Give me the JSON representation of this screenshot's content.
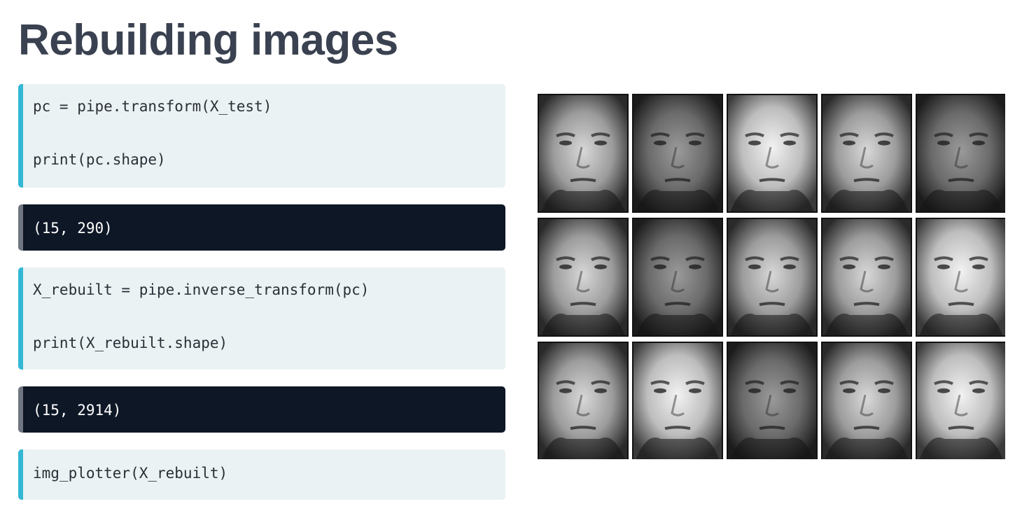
{
  "slide": {
    "title": "Rebuilding images"
  },
  "code_cells": [
    {
      "kind": "input",
      "lines": [
        "pc = pipe.transform(X_test)",
        "print(pc.shape)"
      ]
    },
    {
      "kind": "output",
      "lines": [
        "(15, 290)"
      ]
    },
    {
      "kind": "input",
      "lines": [
        "X_rebuilt = pipe.inverse_transform(pc)",
        "print(X_rebuilt.shape)"
      ]
    },
    {
      "kind": "output",
      "lines": [
        "(15, 2914)"
      ]
    },
    {
      "kind": "input",
      "lines": [
        "img_plotter(X_rebuilt)"
      ]
    }
  ],
  "face_grid": {
    "rows": 3,
    "cols": 5,
    "colors": {
      "input_bg": "#eaf2f4",
      "input_accent": "#33b7d4",
      "output_bg": "#0e1726",
      "output_accent": "#6f7680",
      "title": "#3a4150"
    }
  }
}
